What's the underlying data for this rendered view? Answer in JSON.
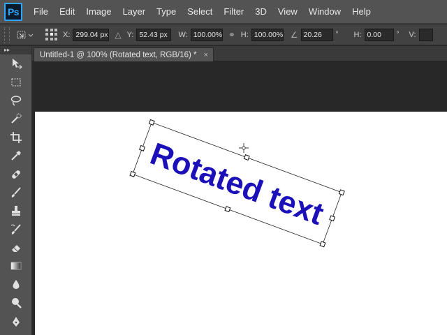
{
  "app": {
    "logo_text": "Ps",
    "menu": [
      "File",
      "Edit",
      "Image",
      "Layer",
      "Type",
      "Select",
      "Filter",
      "3D",
      "View",
      "Window",
      "Help"
    ]
  },
  "options": {
    "x_label": "X:",
    "x_value": "299.04 px",
    "y_label": "Y:",
    "y_value": "52.43 px",
    "w_label": "W:",
    "w_value": "100.00%",
    "h_label": "H:",
    "h_value": "100.00%",
    "angle_value": "20.26",
    "angle_unit": "°",
    "hskew_label": "H:",
    "hskew_value": "0.00",
    "hskew_unit": "°",
    "vskew_label": "V:"
  },
  "toolbar": {
    "collapse_glyph": "▸▸",
    "tools": [
      "move-tool-icon",
      "rectangular-marquee-tool-icon",
      "lasso-tool-icon",
      "quick-selection-tool-icon",
      "crop-tool-icon",
      "eyedropper-tool-icon",
      "spot-healing-brush-tool-icon",
      "brush-tool-icon",
      "clone-stamp-tool-icon",
      "history-brush-tool-icon",
      "eraser-tool-icon",
      "gradient-tool-icon",
      "blur-tool-icon",
      "dodge-tool-icon",
      "pen-tool-icon"
    ]
  },
  "document": {
    "tab_title": "Untitled-1 @ 100% (Rotated text, RGB/16) *",
    "close_glyph": "×",
    "text_layer": "Rotated text",
    "text_color": "#1c11b8",
    "rotation_deg": 20.26
  },
  "colors": {
    "menubar_bg": "#535353",
    "options_bg": "#424242",
    "workspace_bg": "#282828",
    "logo_accent": "#31a8ff"
  }
}
